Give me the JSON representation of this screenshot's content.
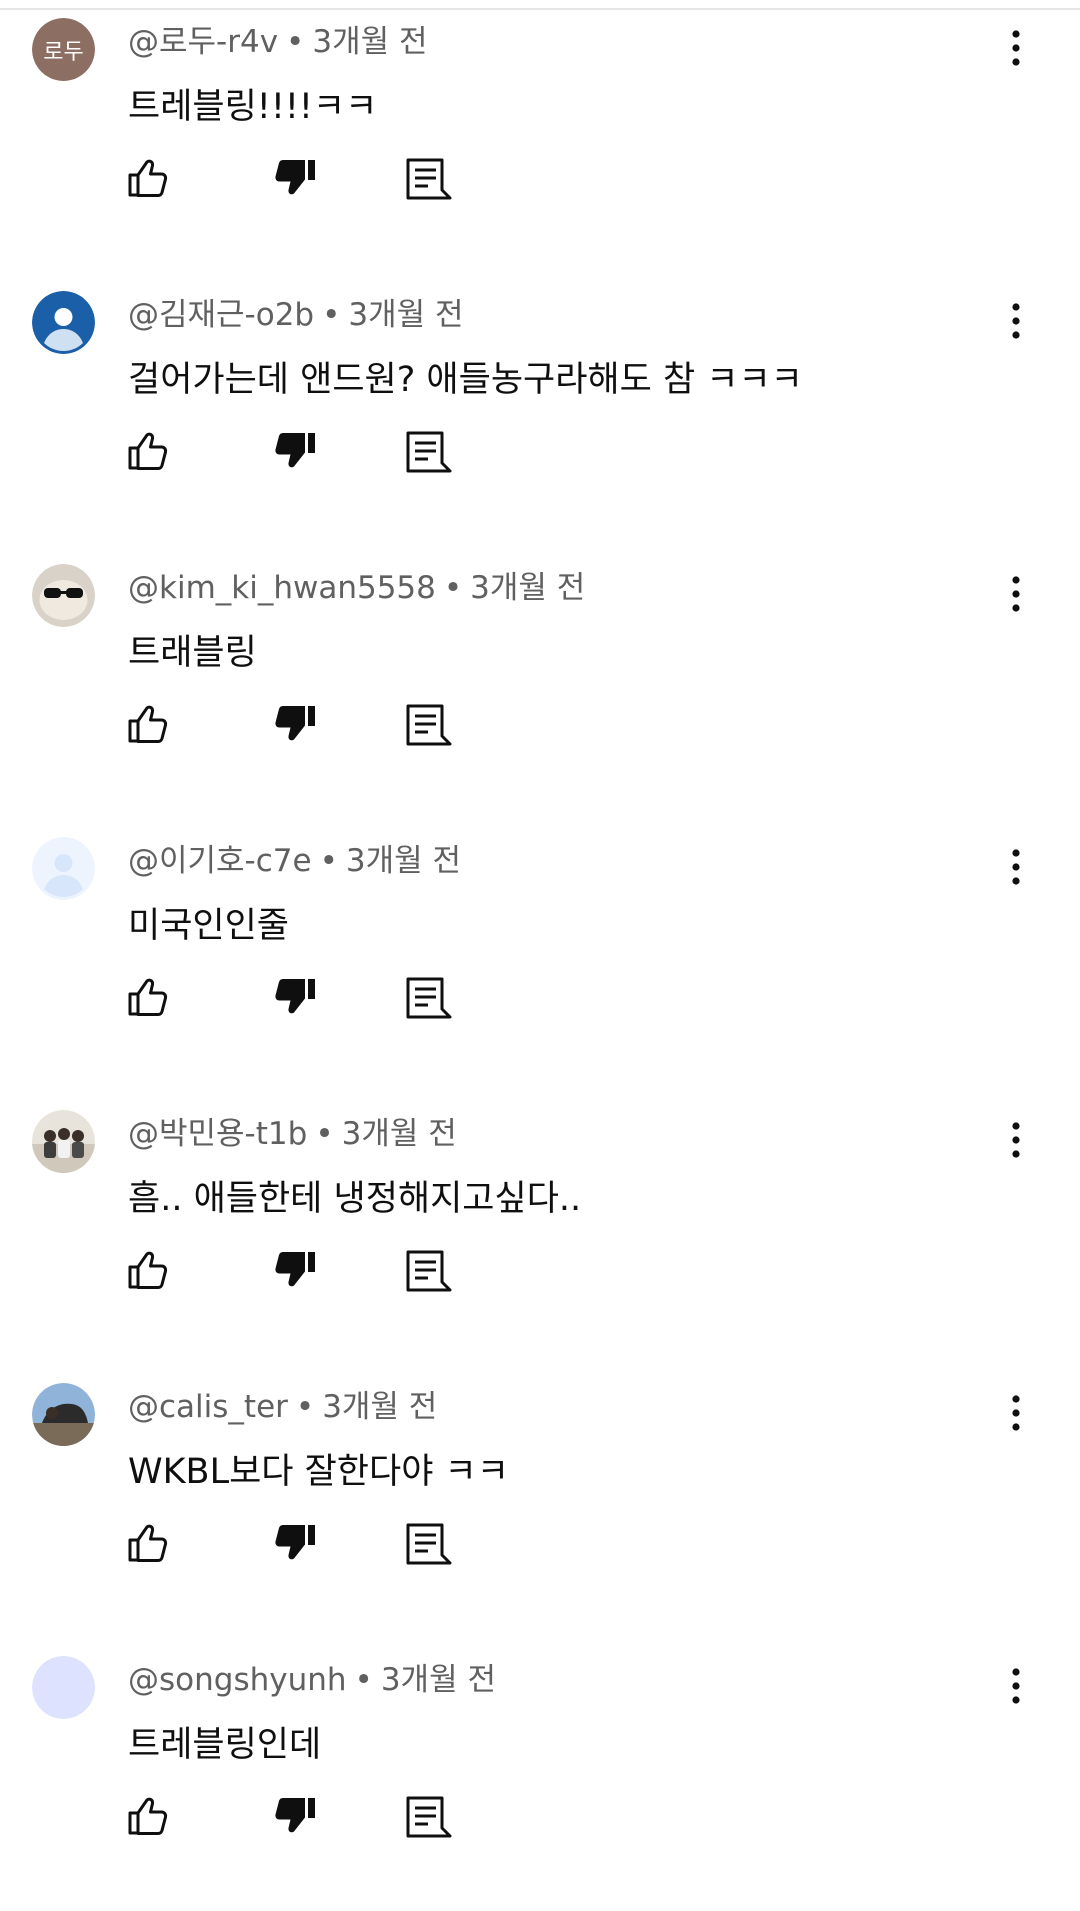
{
  "comments": [
    {
      "avatar_text": "로두",
      "username": "@로두-r4v",
      "separator": "•",
      "time": "3개월 전",
      "text": "트레블링!!!!ㅋㅋ"
    },
    {
      "username": "@김재근-o2b",
      "separator": "•",
      "time": "3개월 전",
      "text": "걸어가는데 앤드원? 애들농구라해도 참 ㅋㅋㅋ"
    },
    {
      "username": "@kim_ki_hwan5558",
      "separator": "•",
      "time": "3개월 전",
      "text": "트래블링"
    },
    {
      "username": "@이기호-c7e",
      "separator": "•",
      "time": "3개월 전",
      "text": "미국인인줄"
    },
    {
      "username": "@박민용-t1b",
      "separator": "•",
      "time": "3개월 전",
      "text": "흠.. 애들한테 냉정해지고싶다.."
    },
    {
      "username": "@calis_ter",
      "separator": "•",
      "time": "3개월 전",
      "text": "WKBL보다 잘한다야 ㅋㅋ"
    },
    {
      "username": "@songshyunh",
      "separator": "•",
      "time": "3개월 전",
      "text": "트레블링인데"
    }
  ],
  "icons": {
    "more": "more-vert-icon",
    "like": "thumb-up-outline-icon",
    "dislike": "thumb-down-filled-icon",
    "reply": "comment-reply-icon"
  },
  "colors": {
    "meta_text": "#606060",
    "body_text": "#0f0f0f",
    "avatar_1": "#8d6e63",
    "avatar_2": "#1a5fa8",
    "avatar_4": "#d7e6fb",
    "avatar_7": "#dde3ff"
  }
}
